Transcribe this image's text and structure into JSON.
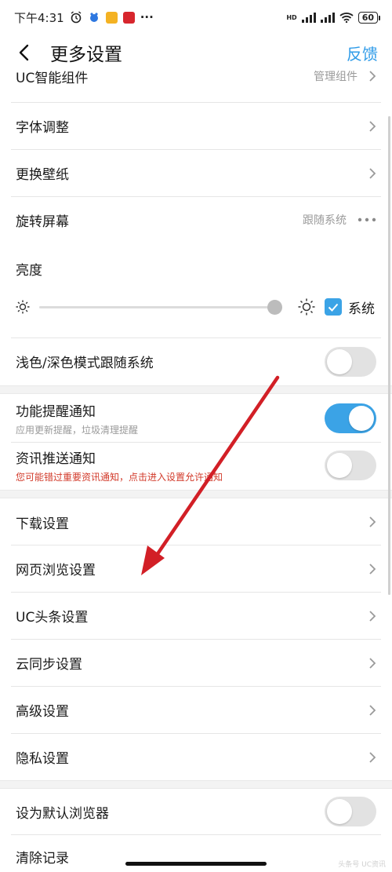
{
  "status_bar": {
    "time": "下午4:31",
    "dots": "···",
    "network": "HD",
    "battery": "60"
  },
  "header": {
    "title": "更多设置",
    "action": "反馈"
  },
  "rows": [
    {
      "label": "UC智能组件",
      "value": "管理组件"
    },
    {
      "label": "字体调整"
    },
    {
      "label": "更换壁纸"
    },
    {
      "label": "旋转屏幕",
      "value": "跟随系统"
    },
    {
      "label": "亮度"
    },
    {
      "label": "浅色/深色模式跟随系统"
    },
    {
      "label": "功能提醒通知",
      "sub": "应用更新提醒，垃圾清理提醒"
    },
    {
      "label": "资讯推送通知",
      "sub": "您可能错过重要资讯通知，点击进入设置允许通知"
    },
    {
      "label": "下载设置"
    },
    {
      "label": "网页浏览设置"
    },
    {
      "label": "UC头条设置"
    },
    {
      "label": "云同步设置"
    },
    {
      "label": "高级设置"
    },
    {
      "label": "隐私设置"
    },
    {
      "label": "设为默认浏览器"
    },
    {
      "label": "清除记录"
    }
  ],
  "brightness": {
    "level": 0.97,
    "system_checked": true,
    "system_label": "系统"
  },
  "toggles": {
    "follow_system_theme": false,
    "feature_notify": true,
    "news_push": false,
    "default_browser": false
  },
  "colors": {
    "accent": "#3ba3e6",
    "warning": "#d23a2a",
    "arrow": "#d21f26"
  },
  "watermark": "头条号 UC资讯"
}
